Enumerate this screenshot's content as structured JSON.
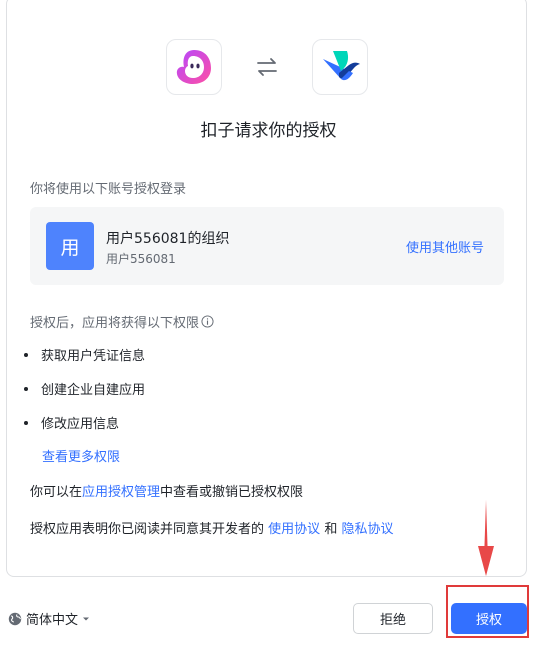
{
  "header": {
    "title": "扣子请求你的授权",
    "left_app_icon": "kouzi-logo-icon",
    "right_app_icon": "feishu-logo-icon",
    "swap_icon": "swap-arrows-icon"
  },
  "account": {
    "prompt": "你将使用以下账号授权登录",
    "avatar_text": "用",
    "name": "用户556081的组织",
    "sub": "用户556081",
    "switch_label": "使用其他账号"
  },
  "permissions": {
    "heading": "授权后，应用将获得以下权限",
    "items": [
      "获取用户凭证信息",
      "创建企业自建应用",
      "修改应用信息"
    ],
    "more_label": "查看更多权限"
  },
  "manage": {
    "prefix": "你可以在",
    "link": "应用授权管理",
    "suffix": "中查看或撤销已授权权限"
  },
  "agreement": {
    "prefix": "授权应用表明你已阅读并同意其开发者的",
    "terms_link": "使用协议",
    "and": "和",
    "privacy_link": "隐私协议"
  },
  "footer": {
    "language": "简体中文",
    "reject_label": "拒绝",
    "authorize_label": "授权"
  },
  "colors": {
    "primary": "#3370ff",
    "avatar": "#4e83fd",
    "annotation": "#e03a3a"
  }
}
